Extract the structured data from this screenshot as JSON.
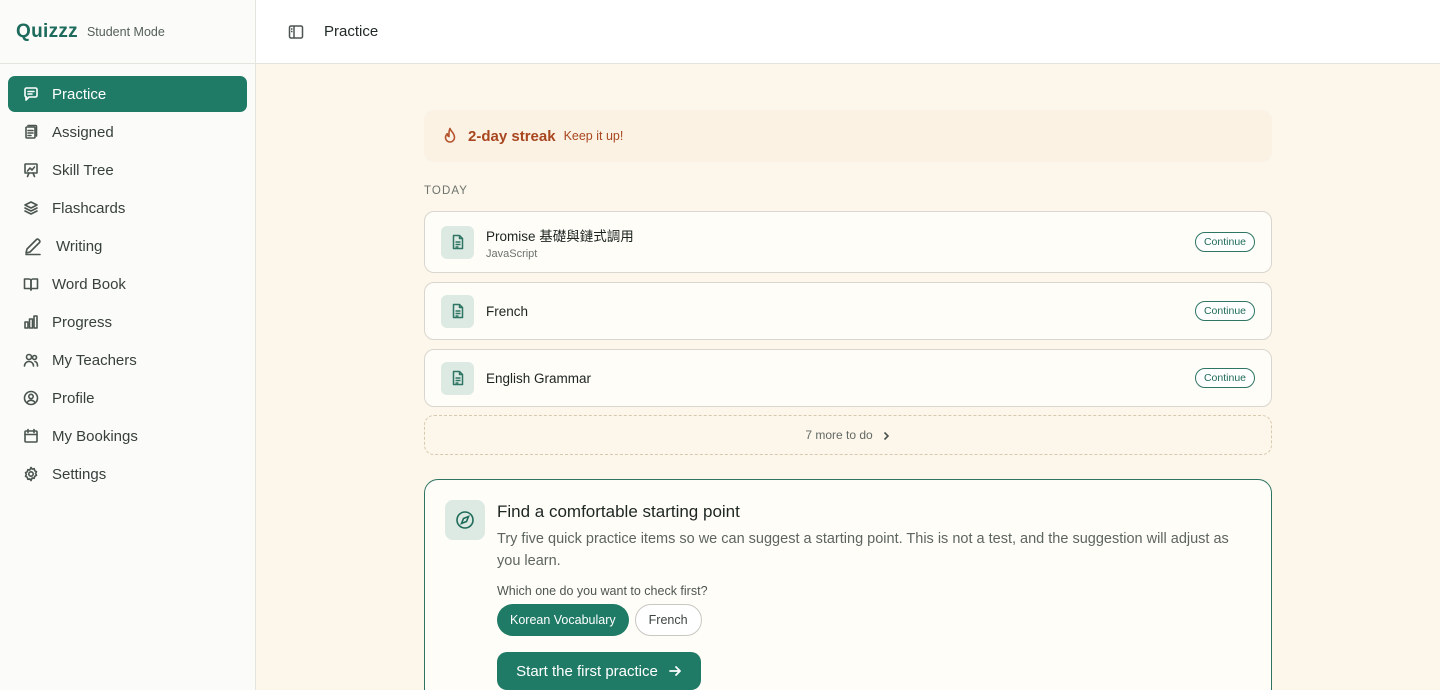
{
  "brand": {
    "logo": "Quizzz",
    "mode": "Student Mode"
  },
  "sidebar": {
    "items": [
      {
        "label": "Practice",
        "icon": "chat-icon",
        "active": true
      },
      {
        "label": "Assigned",
        "icon": "clipboard-icon"
      },
      {
        "label": "Skill Tree",
        "icon": "presentation-chart-icon"
      },
      {
        "label": "Flashcards",
        "icon": "layers-icon"
      },
      {
        "label": "Writing",
        "icon": "pencil-icon"
      },
      {
        "label": "Word Book",
        "icon": "book-open-icon"
      },
      {
        "label": "Progress",
        "icon": "bar-chart-icon"
      },
      {
        "label": "My Teachers",
        "icon": "users-icon"
      },
      {
        "label": "Profile",
        "icon": "user-circle-icon"
      },
      {
        "label": "My Bookings",
        "icon": "calendar-icon"
      },
      {
        "label": "Settings",
        "icon": "gear-icon"
      }
    ]
  },
  "header": {
    "title": "Practice",
    "toggle_icon": "sidebar-toggle-icon"
  },
  "streak": {
    "label": "2-day streak",
    "sub": "Keep it up!",
    "icon": "flame-icon"
  },
  "today": {
    "section_label": "TODAY",
    "tasks": [
      {
        "name": "Promise 基礎與鏈式調用",
        "meta": "JavaScript",
        "button": "Continue"
      },
      {
        "name": "French",
        "meta": "",
        "button": "Continue"
      },
      {
        "name": "English Grammar",
        "meta": "",
        "button": "Continue"
      }
    ],
    "more": "7 more to do"
  },
  "start": {
    "title": "Find a comfortable starting point",
    "description": "Try five quick practice items so we can suggest a starting point. This is not a test, and the suggestion will adjust as you learn.",
    "question": "Which one do you want to check first?",
    "options": [
      {
        "label": "Korean Vocabulary",
        "selected": true
      },
      {
        "label": "French",
        "selected": false
      }
    ],
    "cta": "Start the first practice"
  },
  "colors": {
    "accent": "#1f7a66",
    "streak": "#a8461f",
    "background": "#fdf6ea"
  }
}
